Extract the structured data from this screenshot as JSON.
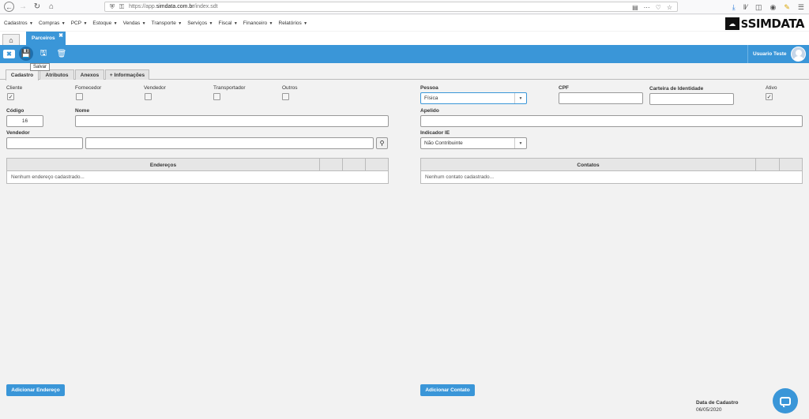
{
  "browser": {
    "url_prefix": "https://app.",
    "url_domain": "simdata.com.br",
    "url_path": "/index.sdt",
    "back_icon": "arrow-left-icon",
    "forward_icon": "arrow-right-icon",
    "reload_icon": "reload-icon",
    "home_icon": "home-icon"
  },
  "menu": {
    "items": [
      {
        "label": "Cadastros"
      },
      {
        "label": "Compras"
      },
      {
        "label": "PCP"
      },
      {
        "label": "Estoque"
      },
      {
        "label": "Vendas"
      },
      {
        "label": "Transporte"
      },
      {
        "label": "Serviços"
      },
      {
        "label": "Fiscal"
      },
      {
        "label": "Financeiro"
      },
      {
        "label": "Relatórios"
      }
    ]
  },
  "logo": {
    "text_s": "S",
    "text_rest": "SIMDATA"
  },
  "tabs": {
    "page_tab": "Parceiros"
  },
  "toolbar": {
    "tooltip": "Salvar",
    "user_name": "Usuario Teste"
  },
  "form_tabs": [
    "Cadastro",
    "Atributos",
    "Anexos",
    "+ Informações"
  ],
  "form": {
    "cliente_label": "Cliente",
    "fornecedor_label": "Fornecedor",
    "vendedor_chk_label": "Vendedor",
    "transportador_label": "Transportador",
    "outros_label": "Outros",
    "pessoa_label": "Pessoa",
    "pessoa_value": "Física",
    "cpf_label": "CPF",
    "rg_label": "Carteira de Identidade",
    "ativo_label": "Ativo",
    "codigo_label": "Código",
    "codigo_value": "16",
    "nome_label": "Nome",
    "apelido_label": "Apelido",
    "vendedor_label": "Vendedor",
    "indicador_label": "Indicador IE",
    "indicador_value": "Não Contribuinte"
  },
  "enderecos": {
    "title": "Endereços",
    "empty": "Nenhum endereço cadastrado...",
    "add_button": "Adicionar Endereço"
  },
  "contatos": {
    "title": "Contatos",
    "empty": "Nenhum contato cadastrado...",
    "add_button": "Adicionar Contato"
  },
  "cadastro": {
    "label": "Data de Cadastro",
    "date": "06/05/2020"
  },
  "colors": {
    "accent": "#3a96d8"
  }
}
